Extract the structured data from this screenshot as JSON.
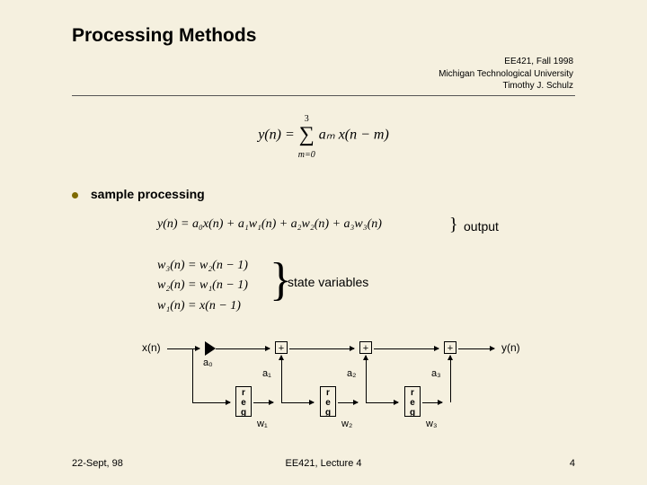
{
  "title": "Processing Methods",
  "meta": {
    "course": "EE421, Fall 1998",
    "univ": "Michigan Technological University",
    "author": "Timothy J. Schulz"
  },
  "sum_eq": {
    "lhs": "y(n) = ",
    "upper": "3",
    "sigma": "∑",
    "lower": "m=0",
    "body": " aₘ x(n − m)"
  },
  "bullet": "sample processing",
  "eq_output": "y(n) = a₀x(n) + a₁w₁(n) + a₂w₂(n) + a₃w₃(n)",
  "label_output": "output",
  "eq_state": {
    "l1": "w₃(n) = w₂(n − 1)",
    "l2": "w₂(n) = w₁(n − 1)",
    "l3": "w₁(n) = x(n − 1)"
  },
  "label_state": "state variables",
  "diagram": {
    "xin": "x(n)",
    "yout": "y(n)",
    "a0": "a₀",
    "a1": "a₁",
    "a2": "a₂",
    "a3": "a₃",
    "w1": "w₁",
    "w2": "w₂",
    "w3": "w₃",
    "reg": "r\ne\ng",
    "plus": "+"
  },
  "footer": {
    "left": "22-Sept, 98",
    "center": "EE421, Lecture 4",
    "right": "4"
  },
  "braces": {
    "out": "}",
    "state": "}"
  }
}
